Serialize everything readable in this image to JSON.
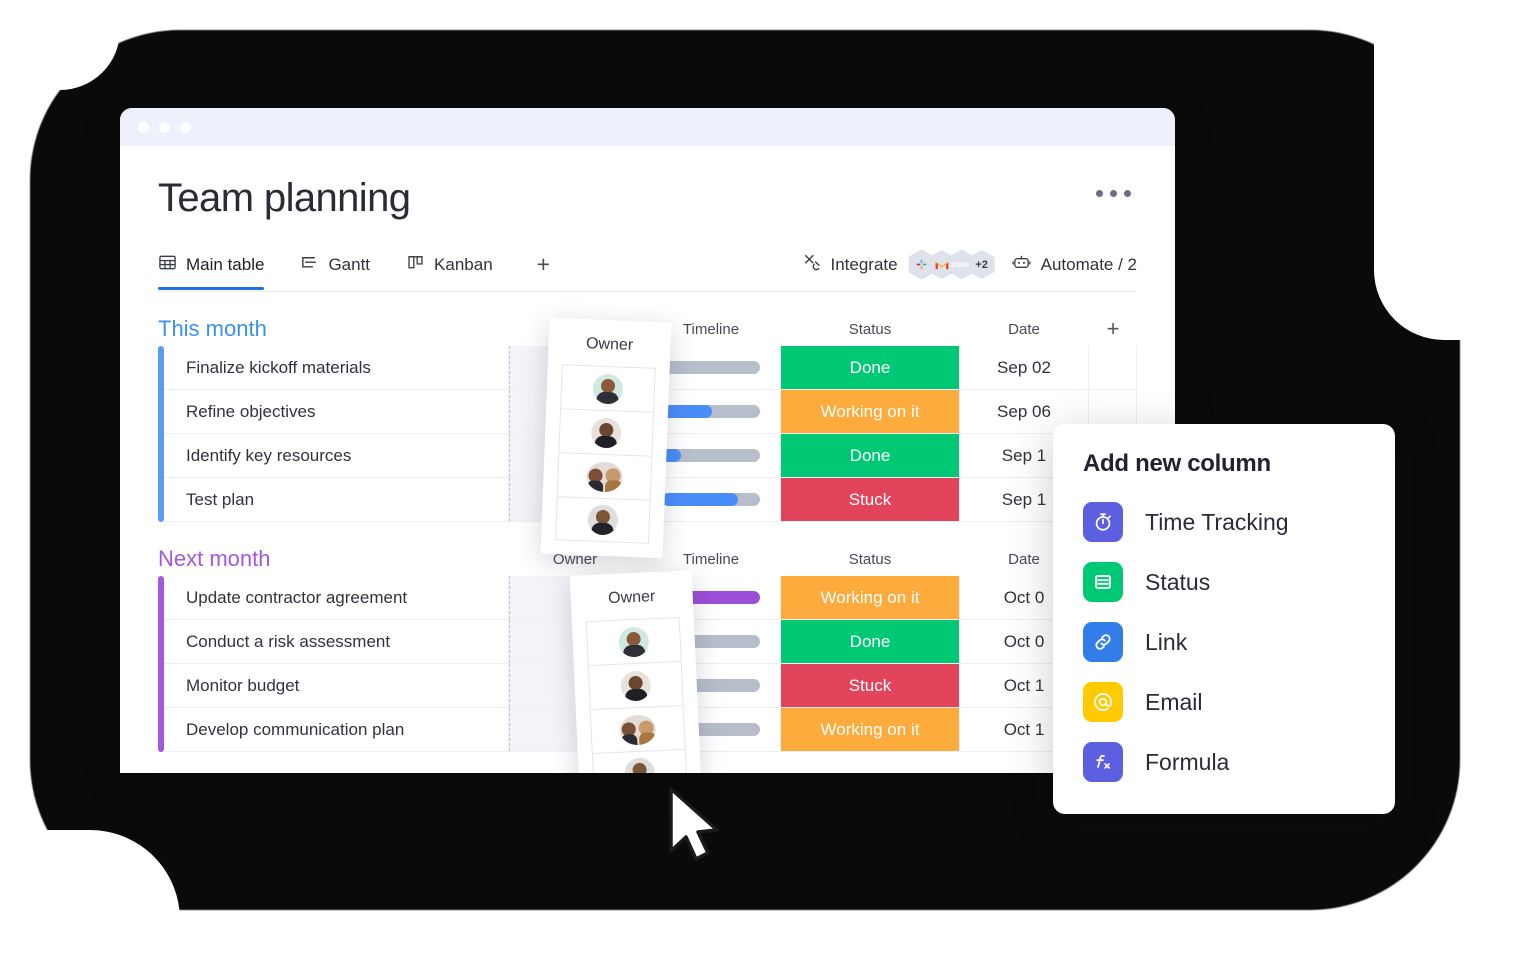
{
  "window": {
    "dots": [
      "dot-1",
      "dot-2",
      "dot-3"
    ]
  },
  "header": {
    "title": "Team planning",
    "menu_icon": "kebab-menu-icon"
  },
  "tabs": [
    {
      "label": "Main table",
      "icon": "grid-icon",
      "active": true
    },
    {
      "label": "Gantt",
      "icon": "gantt-icon",
      "active": false
    },
    {
      "label": "Kanban",
      "icon": "kanban-icon",
      "active": false
    }
  ],
  "tabs_add_label": "+",
  "toolbar": {
    "integrate_label": "Integrate",
    "integrate_icon": "integrate-icon",
    "integration_badges": [
      {
        "name": "slack",
        "label": ""
      },
      {
        "name": "gmail",
        "label": "M"
      },
      {
        "name": "zoom",
        "label": "zoom"
      },
      {
        "name": "more",
        "label": "+2"
      }
    ],
    "automate_label": "Automate / 2",
    "automate_icon": "robot-icon"
  },
  "columns": {
    "owner": "Owner",
    "timeline": "Timeline",
    "status": "Status",
    "date": "Date",
    "add": "+"
  },
  "groups": [
    {
      "title": "This month",
      "color": "#3b91f0",
      "rail": "rail-blue",
      "rows": [
        {
          "name": "Finalize kickoff materials",
          "timeline_fill": 0,
          "fill_color": "blue",
          "status": "Done",
          "status_class": "st-done",
          "date": "Sep 02"
        },
        {
          "name": "Refine objectives",
          "timeline_fill": 52,
          "fill_color": "blue",
          "status": "Working on it",
          "status_class": "st-working",
          "date": "Sep 06"
        },
        {
          "name": "Identify key resources",
          "timeline_fill": 20,
          "fill_color": "blue",
          "status": "Done",
          "status_class": "st-done",
          "date": "Sep 1"
        },
        {
          "name": "Test plan",
          "timeline_fill": 78,
          "fill_color": "blue",
          "status": "Stuck",
          "status_class": "st-stuck",
          "date": "Sep 1"
        }
      ]
    },
    {
      "title": "Next month",
      "color": "#a358df",
      "rail": "rail-purple",
      "rows": [
        {
          "name": "Update contractor agreement",
          "timeline_fill": 100,
          "fill_color": "purple",
          "status": "Working on it",
          "status_class": "st-working",
          "date": "Oct 0"
        },
        {
          "name": "Conduct a risk assessment",
          "timeline_fill": 0,
          "fill_color": "blue",
          "status": "Done",
          "status_class": "st-done",
          "date": "Oct 0"
        },
        {
          "name": "Monitor budget",
          "timeline_fill": 0,
          "fill_color": "blue",
          "status": "Stuck",
          "status_class": "st-stuck",
          "date": "Oct 1"
        },
        {
          "name": "Develop communication plan",
          "timeline_fill": 0,
          "fill_color": "blue",
          "status": "Working on it",
          "status_class": "st-working",
          "date": "Oct 1"
        }
      ]
    }
  ],
  "drag_cards": [
    {
      "title": "Owner",
      "avatars": [
        "avatar-person-1",
        "avatar-person-2",
        "avatar-duo",
        "avatar-person-4"
      ]
    },
    {
      "title": "Owner",
      "avatars": [
        "avatar-person-1",
        "avatar-person-2",
        "avatar-duo",
        "avatar-person-4"
      ]
    }
  ],
  "panel": {
    "title": "Add new column",
    "items": [
      {
        "label": "Time Tracking",
        "icon": "stopwatch-icon",
        "color": "#5b5fe0"
      },
      {
        "label": "Status",
        "icon": "status-list-icon",
        "color": "#00c875"
      },
      {
        "label": "Link",
        "icon": "link-icon",
        "color": "#337dea"
      },
      {
        "label": "Email",
        "icon": "at-sign-icon",
        "color": "#ffcb00"
      },
      {
        "label": "Formula",
        "icon": "formula-icon",
        "color": "#5b5fe0"
      }
    ]
  },
  "cursor": {
    "icon": "mouse-pointer-icon"
  }
}
